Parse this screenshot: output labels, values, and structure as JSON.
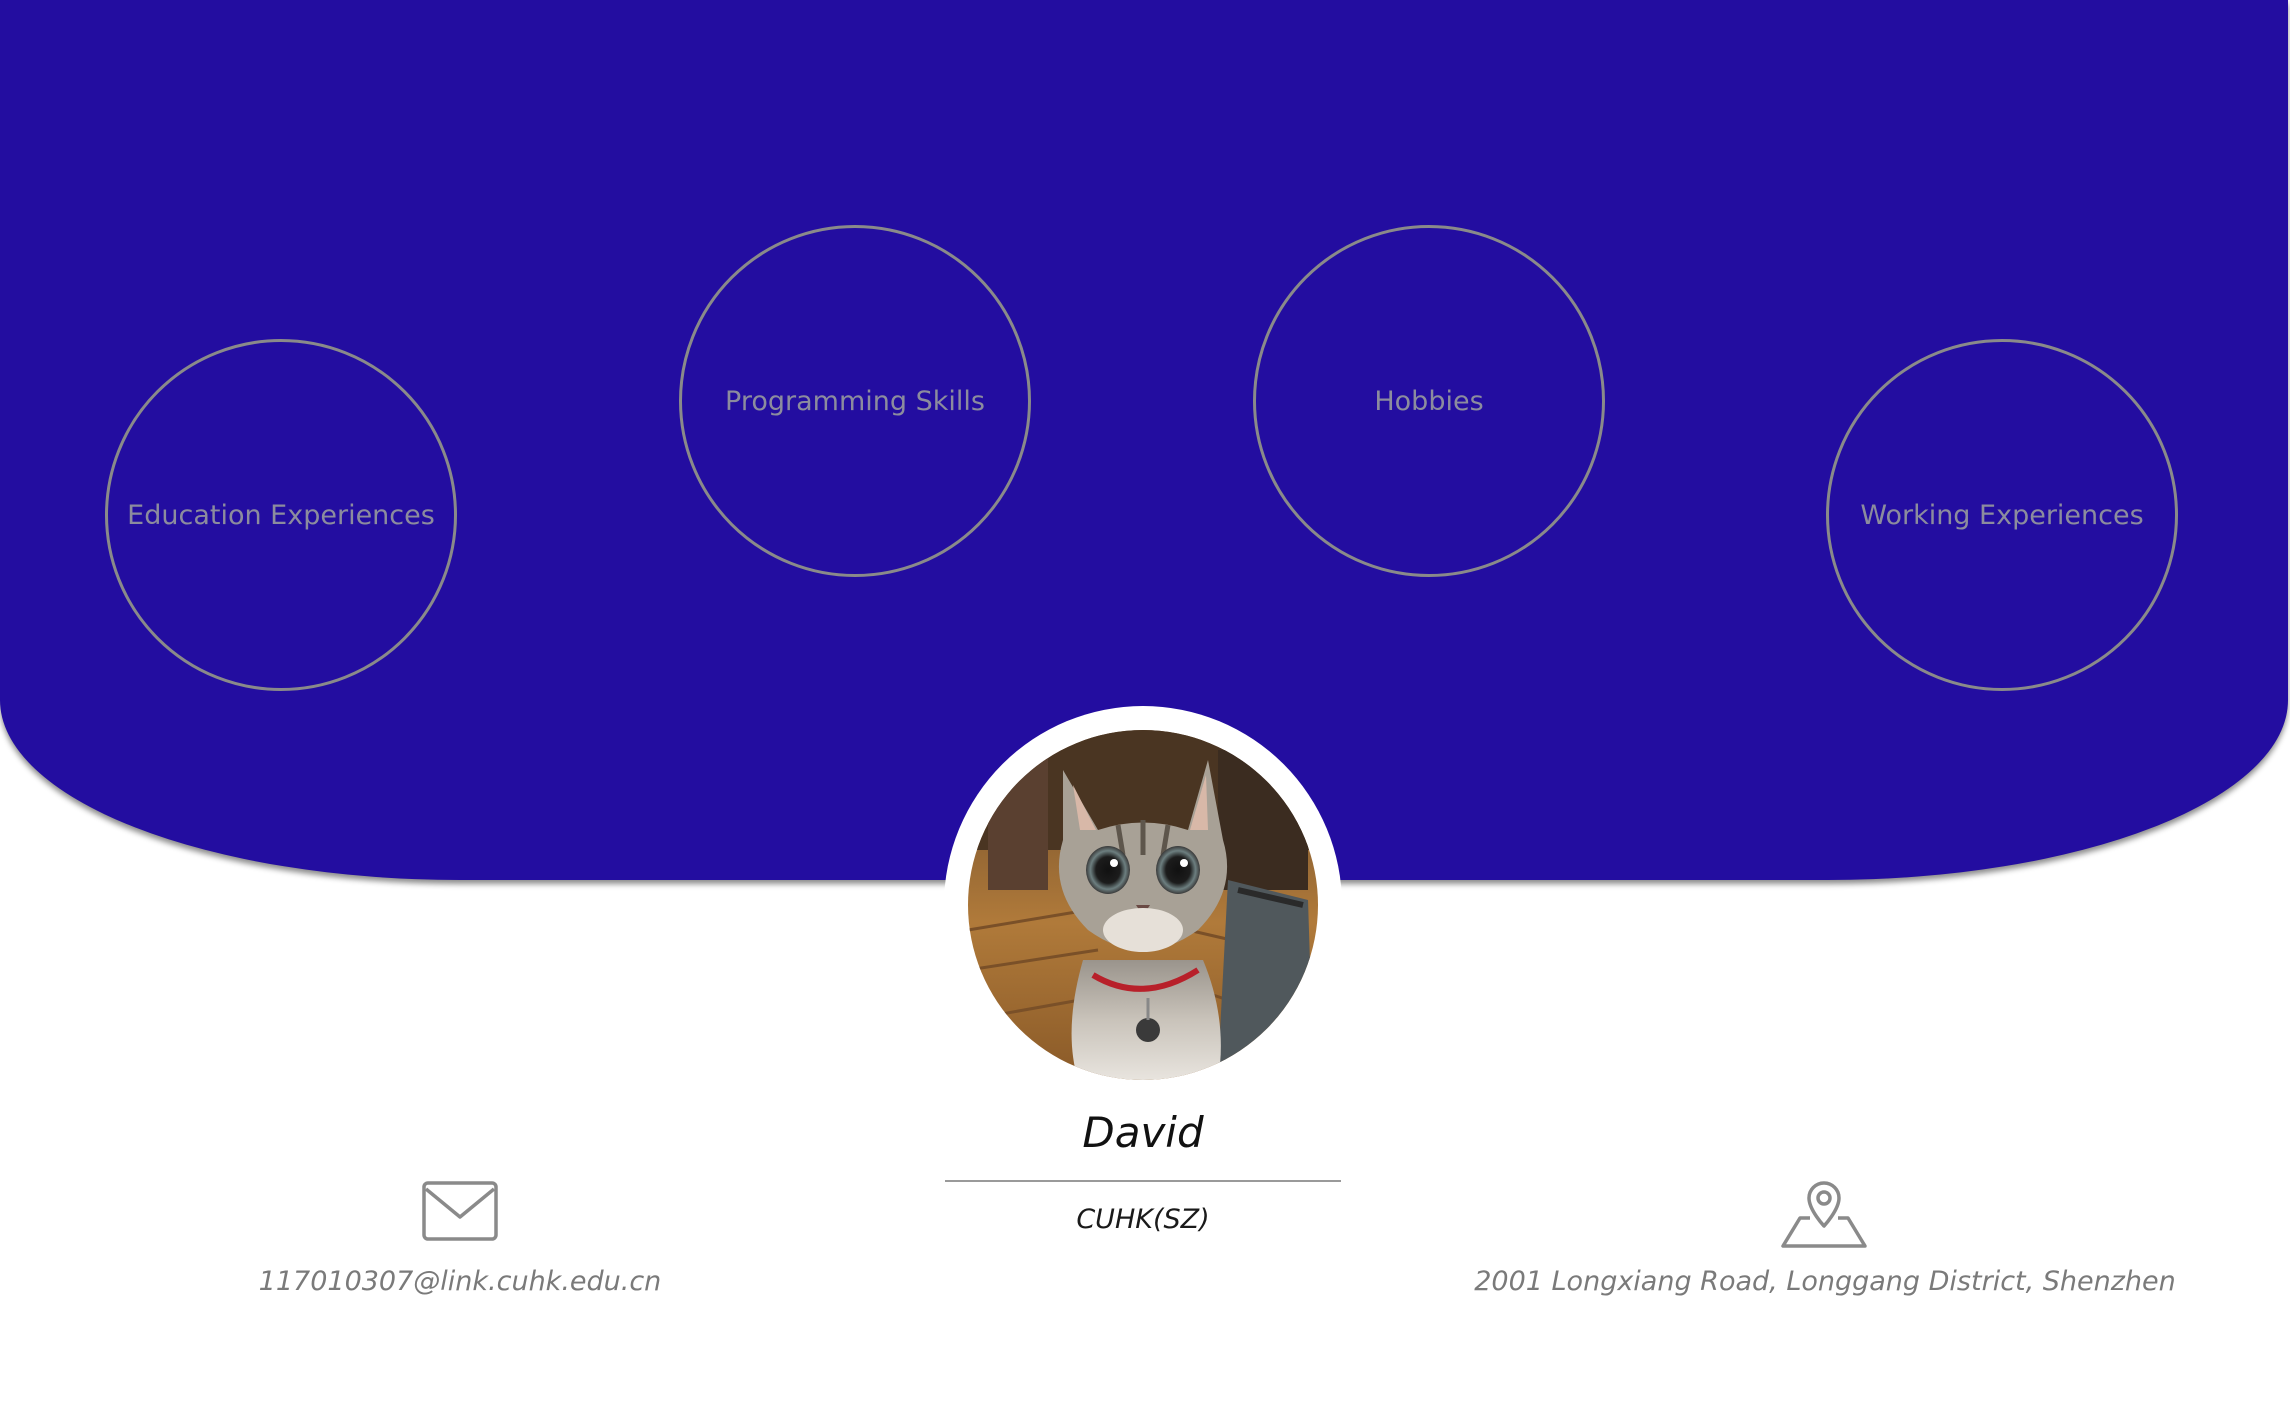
{
  "nav": {
    "education": "Education Experiences",
    "programming": "Programming Skills",
    "hobbies": "Hobbies",
    "working": "Working Experiences"
  },
  "profile": {
    "name": "David",
    "organization": "CUHK(SZ)",
    "avatar_alt": "cat-photo"
  },
  "contact": {
    "email": "117010307@link.cuhk.edu.cn",
    "email_icon": "envelope-icon",
    "address": "2001 Longxiang Road, Longgang District, Shenzhen",
    "address_icon": "map-pin-icon"
  },
  "colors": {
    "hero_background": "#230da0",
    "circle_border": "#8a8a8a",
    "circle_text": "#8c8c9e",
    "muted_text": "#7a7a7a"
  }
}
